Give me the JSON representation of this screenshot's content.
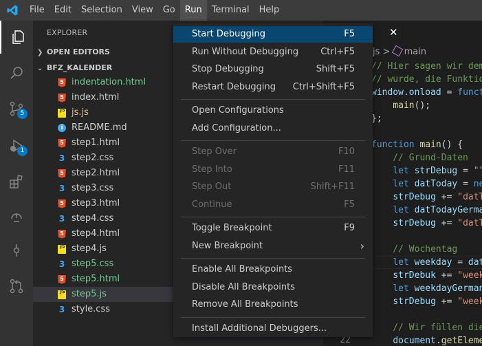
{
  "menubar": {
    "items": [
      "File",
      "Edit",
      "Selection",
      "View",
      "Go",
      "Run",
      "Terminal",
      "Help"
    ],
    "active": "Run"
  },
  "activitybar": {
    "icons": [
      "explorer-icon",
      "search-icon",
      "source-control-icon",
      "run-debug-icon",
      "extensions-icon",
      "remote-explorer-icon",
      "timeline-icon",
      "pull-requests-icon"
    ],
    "source_control_badge": "5",
    "run_debug_badge": "1"
  },
  "sidebar": {
    "title": "EXPLORER",
    "open_editors": "OPEN EDITORS",
    "folder": "BFZ_KALENDER",
    "files": [
      {
        "name": "indentation.html",
        "type": "html",
        "color": "green"
      },
      {
        "name": "index.html",
        "type": "html",
        "color": "normal"
      },
      {
        "name": "js.js",
        "type": "js",
        "color": "yellow"
      },
      {
        "name": "README.md",
        "type": "info",
        "color": "normal"
      },
      {
        "name": "step1.html",
        "type": "html",
        "color": "normal"
      },
      {
        "name": "step2.css",
        "type": "css",
        "color": "normal"
      },
      {
        "name": "step2.html",
        "type": "html",
        "color": "normal"
      },
      {
        "name": "step3.css",
        "type": "css",
        "color": "normal"
      },
      {
        "name": "step3.html",
        "type": "html",
        "color": "normal"
      },
      {
        "name": "step4.css",
        "type": "css",
        "color": "normal"
      },
      {
        "name": "step4.html",
        "type": "html",
        "color": "normal"
      },
      {
        "name": "step4.js",
        "type": "js",
        "color": "normal"
      },
      {
        "name": "step5.css",
        "type": "css",
        "color": "green"
      },
      {
        "name": "step5.html",
        "type": "html",
        "color": "green"
      },
      {
        "name": "step5.js",
        "type": "js",
        "color": "green",
        "selected": true
      },
      {
        "name": "style.css",
        "type": "css",
        "color": "normal"
      }
    ]
  },
  "editor": {
    "tab_close": "✕",
    "breadcrumb_file": "js",
    "breadcrumb_sep": " > ",
    "breadcrumb_symbol": "main",
    "line_number_visible": "22",
    "code_lines": [
      [
        {
          "t": "// Hier sagen wir dem ",
          "c": "#6a9955"
        }
      ],
      [
        {
          "t": "// wurde, die Funktion",
          "c": "#6a9955"
        }
      ],
      [
        {
          "t": "window",
          "c": "#9cdcfe"
        },
        {
          "t": ".",
          "c": "#d4d4d4"
        },
        {
          "t": "onload",
          "c": "#9cdcfe"
        },
        {
          "t": " = ",
          "c": "#d4d4d4"
        },
        {
          "t": "functi",
          "c": "#569cd6"
        }
      ],
      [
        {
          "t": "    ",
          "c": "#d4d4d4"
        },
        {
          "t": "main",
          "c": "#dcdcaa"
        },
        {
          "t": "();",
          "c": "#d4d4d4"
        }
      ],
      [
        {
          "t": "};",
          "c": "#d4d4d4"
        }
      ],
      [
        {
          "t": "",
          "c": "#d4d4d4"
        }
      ],
      [
        {
          "t": "function",
          "c": "#569cd6"
        },
        {
          "t": " ",
          "c": "#d4d4d4"
        },
        {
          "t": "main",
          "c": "#dcdcaa"
        },
        {
          "t": "() {",
          "c": "#d4d4d4"
        }
      ],
      [
        {
          "t": "    // Grund-Daten",
          "c": "#6a9955"
        }
      ],
      [
        {
          "t": "    ",
          "c": "#d4d4d4"
        },
        {
          "t": "let",
          "c": "#569cd6"
        },
        {
          "t": " ",
          "c": "#d4d4d4"
        },
        {
          "t": "strDebug",
          "c": "#9cdcfe"
        },
        {
          "t": " = ",
          "c": "#d4d4d4"
        },
        {
          "t": "\"\"",
          "c": "#ce9178"
        },
        {
          "t": ";",
          "c": "#d4d4d4"
        }
      ],
      [
        {
          "t": "    ",
          "c": "#d4d4d4"
        },
        {
          "t": "let",
          "c": "#569cd6"
        },
        {
          "t": " ",
          "c": "#d4d4d4"
        },
        {
          "t": "datToday",
          "c": "#9cdcfe"
        },
        {
          "t": " = ",
          "c": "#d4d4d4"
        },
        {
          "t": "new",
          "c": "#569cd6"
        }
      ],
      [
        {
          "t": "    ",
          "c": "#d4d4d4"
        },
        {
          "t": "strDebug",
          "c": "#9cdcfe"
        },
        {
          "t": " += ",
          "c": "#d4d4d4"
        },
        {
          "t": "\"datTo",
          "c": "#ce9178"
        }
      ],
      [
        {
          "t": "    ",
          "c": "#d4d4d4"
        },
        {
          "t": "let",
          "c": "#569cd6"
        },
        {
          "t": " ",
          "c": "#d4d4d4"
        },
        {
          "t": "datTodayGerman",
          "c": "#9cdcfe"
        }
      ],
      [
        {
          "t": "    ",
          "c": "#d4d4d4"
        },
        {
          "t": "strDebug",
          "c": "#9cdcfe"
        },
        {
          "t": " += ",
          "c": "#d4d4d4"
        },
        {
          "t": "\"datTo",
          "c": "#ce9178"
        }
      ],
      [
        {
          "t": "",
          "c": "#d4d4d4"
        }
      ],
      [
        {
          "t": "    // Wochentag",
          "c": "#6a9955"
        }
      ],
      [
        {
          "t": "    ",
          "c": "#d4d4d4"
        },
        {
          "t": "let",
          "c": "#569cd6"
        },
        {
          "t": " ",
          "c": "#d4d4d4"
        },
        {
          "t": "weekday",
          "c": "#9cdcfe"
        },
        {
          "t": " = ",
          "c": "#d4d4d4"
        },
        {
          "t": "datT",
          "c": "#9cdcfe"
        }
      ],
      [
        {
          "t": "    ",
          "c": "#d4d4d4"
        },
        {
          "t": "strDebuk",
          "c": "#9cdcfe"
        },
        {
          "t": " += ",
          "c": "#d4d4d4"
        },
        {
          "t": "\"weekd",
          "c": "#ce9178"
        }
      ],
      [
        {
          "t": "    ",
          "c": "#d4d4d4"
        },
        {
          "t": "let",
          "c": "#569cd6"
        },
        {
          "t": " ",
          "c": "#d4d4d4"
        },
        {
          "t": "weekdayGerman",
          "c": "#9cdcfe"
        }
      ],
      [
        {
          "t": "    ",
          "c": "#d4d4d4"
        },
        {
          "t": "strDebug",
          "c": "#9cdcfe"
        },
        {
          "t": " += ",
          "c": "#d4d4d4"
        },
        {
          "t": "\"weekd",
          "c": "#ce9178"
        }
      ],
      [
        {
          "t": "",
          "c": "#d4d4d4"
        }
      ],
      [
        {
          "t": "    // Wir füllen die",
          "c": "#6a9955"
        }
      ],
      [
        {
          "t": "    ",
          "c": "#d4d4d4"
        },
        {
          "t": "document",
          "c": "#9cdcfe"
        },
        {
          "t": ".",
          "c": "#d4d4d4"
        },
        {
          "t": "getElemen",
          "c": "#dcdcaa"
        }
      ]
    ]
  },
  "run_menu": {
    "groups": [
      [
        {
          "label": "Start Debugging",
          "shortcut": "F5",
          "highlight": true
        },
        {
          "label": "Run Without Debugging",
          "shortcut": "Ctrl+F5"
        },
        {
          "label": "Stop Debugging",
          "shortcut": "Shift+F5"
        },
        {
          "label": "Restart Debugging",
          "shortcut": "Ctrl+Shift+F5"
        }
      ],
      [
        {
          "label": "Open Configurations",
          "shortcut": ""
        },
        {
          "label": "Add Configuration...",
          "shortcut": ""
        }
      ],
      [
        {
          "label": "Step Over",
          "shortcut": "F10",
          "disabled": true
        },
        {
          "label": "Step Into",
          "shortcut": "F11",
          "disabled": true
        },
        {
          "label": "Step Out",
          "shortcut": "Shift+F11",
          "disabled": true
        },
        {
          "label": "Continue",
          "shortcut": "F5",
          "disabled": true
        }
      ],
      [
        {
          "label": "Toggle Breakpoint",
          "shortcut": "F9"
        },
        {
          "label": "New Breakpoint",
          "shortcut": "",
          "submenu": true
        }
      ],
      [
        {
          "label": "Enable All Breakpoints",
          "shortcut": ""
        },
        {
          "label": "Disable All Breakpoints",
          "shortcut": ""
        },
        {
          "label": "Remove All Breakpoints",
          "shortcut": ""
        }
      ],
      [
        {
          "label": "Install Additional Debuggers...",
          "shortcut": ""
        }
      ]
    ]
  },
  "colors": {
    "accent": "#007acc",
    "menu_highlight": "#094771",
    "git_added": "#73c991",
    "git_modified": "#e2c08d"
  }
}
